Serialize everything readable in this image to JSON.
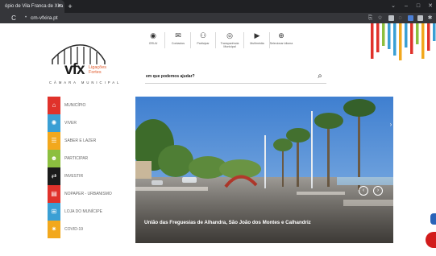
{
  "browser": {
    "tab_title": "ópio de Vila Franca de Xira",
    "tab_close": "×",
    "new_tab": "+",
    "url": "cm-vfxira.pt",
    "reload": "C",
    "lock": "🔒",
    "win_min": "–",
    "win_max": "□",
    "win_close": "✕",
    "win_drop": "⌄"
  },
  "logo": {
    "mark": "vfx",
    "tagline_1": "Ligações",
    "tagline_2": "Fortes",
    "subtitle": "CÂMARA MUNICIPAL"
  },
  "topnav": [
    {
      "label": "GRUU",
      "icon": "eye-icon",
      "glyph": "◉"
    },
    {
      "label": "Contactos",
      "icon": "mail-icon",
      "glyph": "✉"
    },
    {
      "label": "Participar",
      "icon": "people-icon",
      "glyph": "⚇"
    },
    {
      "label": "Transparência Municipal",
      "icon": "view-icon",
      "glyph": "◎"
    },
    {
      "label": "Multimédia",
      "icon": "play-icon",
      "glyph": "▶"
    },
    {
      "label": "Selecionar idioma",
      "icon": "globe-icon",
      "glyph": "⊕"
    }
  ],
  "search": {
    "label": "em que podemos ajudar?",
    "icon_glyph": "⌕"
  },
  "sidebar": {
    "items": [
      {
        "label": "MUNICÍPIO",
        "color": "#e0322b",
        "icon": "building-icon",
        "glyph": "⌂"
      },
      {
        "label": "VIVER",
        "color": "#3a9fd4",
        "icon": "gear-icon",
        "glyph": "✺"
      },
      {
        "label": "SABER E LAZER",
        "color": "#f2a81d",
        "icon": "book-icon",
        "glyph": "☰"
      },
      {
        "label": "PARTICIPAR",
        "color": "#8cbf3f",
        "icon": "people-icon",
        "glyph": "☻"
      },
      {
        "label": "INVESTIR",
        "color": "#1b1b1b",
        "icon": "handshake-icon",
        "glyph": "⇄"
      },
      {
        "label": "NOPAPER - URBANISMO",
        "color": "#e0322b",
        "icon": "city-icon",
        "glyph": "▤"
      },
      {
        "label": "LOJA DO MUNÍCIPE",
        "color": "#3a9fd4",
        "icon": "store-icon",
        "glyph": "⊞"
      },
      {
        "label": "COVID-19",
        "color": "#f2a81d",
        "icon": "virus-icon",
        "glyph": "✷"
      }
    ]
  },
  "hero": {
    "caption": "União das Freguesias de Alhandra, São João dos Montes e Calhandriz",
    "prev": "‹",
    "next": "›",
    "side_next": "›"
  },
  "colors": {
    "stripes": [
      "#e0322b",
      "#3a9fd4",
      "#f2a81d",
      "#8cbf3f",
      "#e0322b",
      "#3a9fd4",
      "#f2a81d",
      "#8cbf3f",
      "#e0322b"
    ]
  }
}
